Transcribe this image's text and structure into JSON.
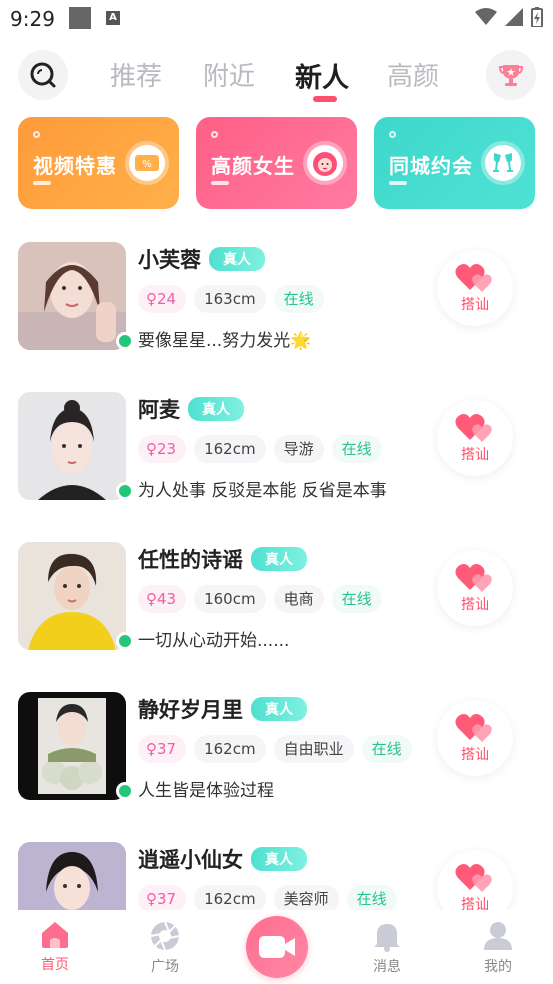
{
  "status_bar": {
    "time": "9:29",
    "a_glyph": "A"
  },
  "topnav": {
    "tabs": [
      {
        "label": "推荐",
        "active": false
      },
      {
        "label": "附近",
        "active": false
      },
      {
        "label": "新人",
        "active": true
      },
      {
        "label": "高颜",
        "active": false
      }
    ],
    "left_icon": "search-icon",
    "right_icon": "trophy-icon"
  },
  "banners": [
    {
      "title": "视频特惠",
      "icon": "coupon-icon",
      "color": "#ff9a3a"
    },
    {
      "title": "高颜女生",
      "icon": "girl-avatar-icon",
      "color": "#ff5f86"
    },
    {
      "title": "同城约会",
      "icon": "cheers-icon",
      "color": "#3fd7cc"
    }
  ],
  "users": [
    {
      "name": "小芙蓉",
      "verified": "真人",
      "age": "24",
      "height": "163cm",
      "job": "",
      "status": "在线",
      "bio": "要像星星...努力发光🌟",
      "greet": "搭讪"
    },
    {
      "name": "阿麦",
      "verified": "真人",
      "age": "23",
      "height": "162cm",
      "job": "导游",
      "status": "在线",
      "bio": "为人处事  反驳是本能  反省是本事",
      "greet": "搭讪"
    },
    {
      "name": "任性的诗谣",
      "verified": "真人",
      "age": "43",
      "height": "160cm",
      "job": "电商",
      "status": "在线",
      "bio": "一切从心动开始......",
      "greet": "搭讪"
    },
    {
      "name": "静好岁月里",
      "verified": "真人",
      "age": "37",
      "height": "162cm",
      "job": "自由职业",
      "status": "在线",
      "bio": "人生皆是体验过程",
      "greet": "搭讪"
    },
    {
      "name": "逍遥小仙女",
      "verified": "真人",
      "age": "37",
      "height": "162cm",
      "job": "美容师",
      "status": "在线",
      "bio": "",
      "greet": "搭讪"
    }
  ],
  "bottom_nav": [
    {
      "label": "首页",
      "icon": "home-icon",
      "active": true
    },
    {
      "label": "广场",
      "icon": "aperture-icon",
      "active": false
    },
    {
      "label": "",
      "icon": "video-camera-icon",
      "active": false
    },
    {
      "label": "消息",
      "icon": "bell-icon",
      "active": false
    },
    {
      "label": "我的",
      "icon": "profile-icon",
      "active": false
    }
  ],
  "colors": {
    "accent": "#ff4f6b",
    "online": "#22c77a",
    "verified": "#4fe0d0"
  }
}
